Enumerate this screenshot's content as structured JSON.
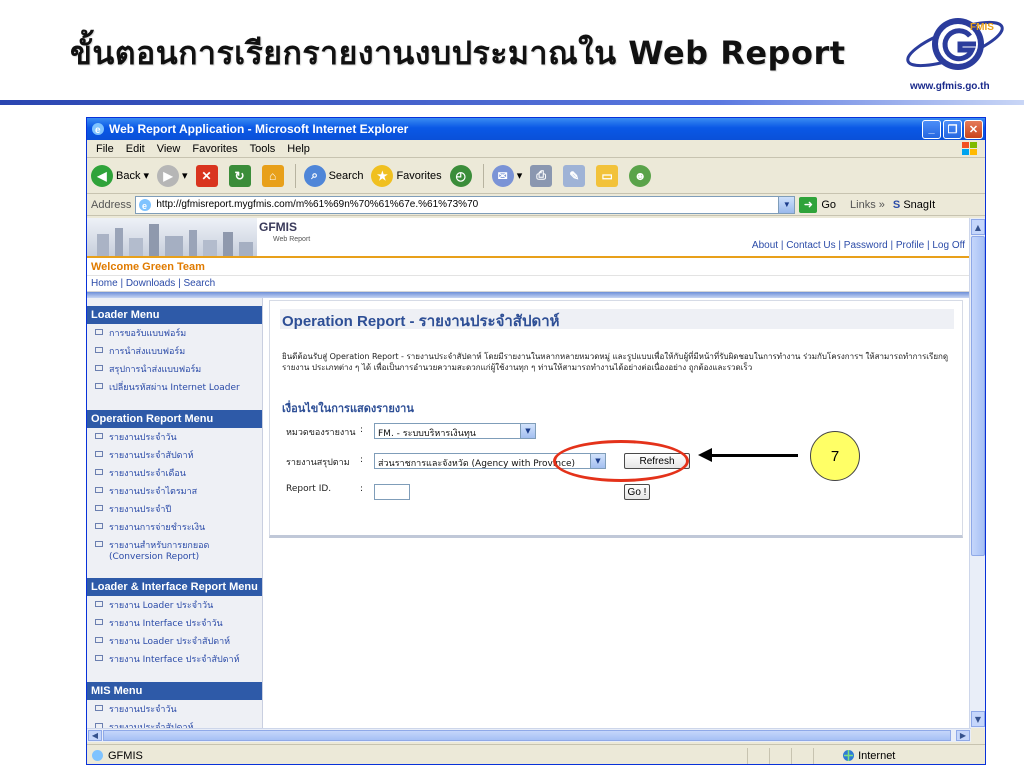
{
  "slide": {
    "title": "ขั้นตอนการเรียกรายงานงบประมาณใน Web Report",
    "logo_url": "www.gfmis.go.th",
    "step_number": "7"
  },
  "browser": {
    "window_title": "Web Report Application - Microsoft Internet Explorer",
    "menu": [
      "File",
      "Edit",
      "View",
      "Favorites",
      "Tools",
      "Help"
    ],
    "toolbar": {
      "back": "Back",
      "search": "Search",
      "favorites": "Favorites"
    },
    "address_label": "Address",
    "address_value": "http://gfmisreport.mygfmis.com/m%61%69n%70%61%67e.%61%73%70",
    "go_label": "Go",
    "links_label": "Links",
    "snagit_label": "SnagIt",
    "status_text": "GFMIS",
    "zone_text": "Internet"
  },
  "site": {
    "name": "GFMIS",
    "subname": "Web Report",
    "top_links": "About | Contact Us | Password | Profile | Log Off",
    "welcome": "Welcome  Green Team",
    "nav": "Home | Downloads | Search"
  },
  "sidebar": {
    "sections": [
      {
        "heading": "Loader Menu",
        "items": [
          "การขอรับแบบฟอร์ม",
          "การนำส่งแบบฟอร์ม",
          "สรุปการนำส่งแบบฟอร์ม",
          "เปลี่ยนรหัสผ่าน Internet Loader"
        ]
      },
      {
        "heading": "Operation Report Menu",
        "items": [
          "รายงานประจำวัน",
          "รายงานประจำสัปดาห์",
          "รายงานประจำเดือน",
          "รายงานประจำไตรมาส",
          "รายงานประจำปี",
          "รายงานการจ่ายชำระเงิน",
          "รายงานสำหรับการยกยอด (Conversion Report)"
        ]
      },
      {
        "heading": "Loader & Interface Report Menu",
        "items": [
          "รายงาน Loader ประจำวัน",
          "รายงาน Interface ประจำวัน",
          "รายงาน Loader ประจำสัปดาห์",
          "รายงาน Interface ประจำสัปดาห์"
        ]
      },
      {
        "heading": "MIS Menu",
        "items": [
          "รายงานประจำวัน",
          "รายงานประจำสัปดาห์"
        ]
      }
    ]
  },
  "main": {
    "title": "Operation Report - รายงานประจำสัปดาห์",
    "description": "ยินดีต้อนรับสู่ Operation Report - รายงานประจำสัปดาห์ โดยมีรายงานในหลากหลายหมวดหมู่ และรูปแบบเพื่อให้กับผู้ที่มีหน้าที่รับผิดชอบในการทำงาน ร่วมกับโครงการฯ ให้สามารถทำการเรียกดูรายงาน ประเภทต่าง ๆ ได้ เพื่อเป็นการอำนวยความสะดวกแก่ผู้ใช้งานทุก ๆ ท่านให้สามารถทำงานได้อย่างต่อเนื่องอย่าง ถูกต้องและรวดเร็ว",
    "subheading": "เงื่อนไขในการแสดงรายงาน",
    "fields": {
      "category_label": "หมวดของรายงาน",
      "category_value": "FM. - ระบบบริหารเงินทุน",
      "summary_label": "รายงานสรุปตาม",
      "summary_value": "ส่วนราชการและจังหวัด (Agency with Province)",
      "report_id_label": "Report ID.",
      "colon": ":"
    },
    "refresh_label": "Refresh",
    "go_button_label": "Go !"
  }
}
